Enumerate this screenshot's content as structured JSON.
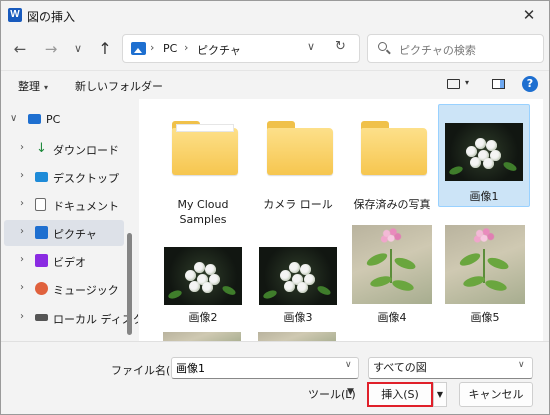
{
  "window": {
    "app_icon": "W",
    "title": "図の挿入",
    "close": "✕"
  },
  "nav": {
    "back": "←",
    "forward": "→",
    "recent": "∨",
    "up": "↑"
  },
  "address": {
    "sep": "›",
    "crumbs": [
      "PC",
      "ピクチャ"
    ],
    "dropdown": "∨",
    "refresh": "↻"
  },
  "search": {
    "placeholder": "ピクチャの検索"
  },
  "toolbar": {
    "organize": "整理",
    "organize_arrow": "▾",
    "new_folder": "新しいフォルダー",
    "view_arrow": "▾",
    "help": "?"
  },
  "sidebar": {
    "items": [
      {
        "label": "PC",
        "chevron": "∨",
        "icon": "pc-icon",
        "color": "#1e6fd0"
      },
      {
        "label": "ダウンロード",
        "chevron": "›",
        "icon": "download-icon",
        "color": "#1e8a3c"
      },
      {
        "label": "デスクトップ",
        "chevron": "›",
        "icon": "desktop-icon",
        "color": "#1e8bd8"
      },
      {
        "label": "ドキュメント",
        "chevron": "›",
        "icon": "document-icon",
        "color": "#6b6b6b"
      },
      {
        "label": "ピクチャ",
        "chevron": "›",
        "icon": "pictures-icon",
        "color": "#1e6fd0"
      },
      {
        "label": "ビデオ",
        "chevron": "›",
        "icon": "video-icon",
        "color": "#8a2be2"
      },
      {
        "label": "ミュージック",
        "chevron": "›",
        "icon": "music-icon",
        "color": "#e0613d"
      },
      {
        "label": "ローカル ディスク (",
        "chevron": "›",
        "icon": "disk-icon",
        "color": "#555555"
      }
    ]
  },
  "files": [
    {
      "label": "My Cloud Samples",
      "type": "folder"
    },
    {
      "label": "カメラ ロール",
      "type": "folder"
    },
    {
      "label": "保存済みの写真",
      "type": "folder"
    },
    {
      "label": "画像1",
      "type": "photo-dark",
      "selected": true
    },
    {
      "label": "画像2",
      "type": "photo-dark"
    },
    {
      "label": "画像3",
      "type": "photo-dark"
    },
    {
      "label": "画像4",
      "type": "photo-light"
    },
    {
      "label": "画像5",
      "type": "photo-light"
    }
  ],
  "bottom": {
    "filename_label": "ファイル名(N):",
    "filename_value": "画像1",
    "dropdown": "∨",
    "filetype": "すべての図",
    "tools": "ツール(L)",
    "tools_arrow": "▼",
    "insert": "挿入(S)",
    "insert_arrow": "▼",
    "cancel": "キャンセル"
  },
  "colors": {
    "accent": "#1e6fd0",
    "selection": "#cce4f7",
    "highlight_border": "#e0202a"
  }
}
